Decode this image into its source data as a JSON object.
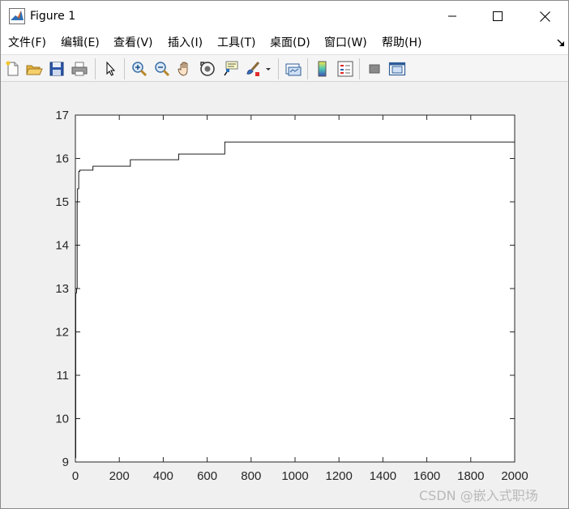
{
  "window": {
    "title": "Figure 1"
  },
  "menu": [
    {
      "label": "文件(F)"
    },
    {
      "label": "编辑(E)"
    },
    {
      "label": "查看(V)"
    },
    {
      "label": "插入(I)"
    },
    {
      "label": "工具(T)"
    },
    {
      "label": "桌面(D)"
    },
    {
      "label": "窗口(W)"
    },
    {
      "label": "帮助(H)"
    }
  ],
  "toolbar": {
    "icons": [
      "new-figure-icon",
      "open-file-icon",
      "save-icon",
      "print-icon",
      "pointer-icon",
      "zoom-in-icon",
      "zoom-out-icon",
      "pan-icon",
      "rotate-3d-icon",
      "data-cursor-icon",
      "brush-icon",
      "brush-dropdown-icon",
      "link-plot-icon",
      "colorbar-icon",
      "legend-icon",
      "hide-plot-tools-icon",
      "show-plot-tools-icon"
    ]
  },
  "chart_data": {
    "type": "line",
    "title": "",
    "xlabel": "",
    "ylabel": "",
    "xlim": [
      0,
      2000
    ],
    "ylim": [
      9,
      17
    ],
    "xticks": [
      0,
      200,
      400,
      600,
      800,
      1000,
      1200,
      1400,
      1600,
      1800,
      2000
    ],
    "yticks": [
      9,
      10,
      11,
      12,
      13,
      14,
      15,
      16,
      17
    ],
    "grid": false,
    "series": [
      {
        "color": "#000000",
        "step": true,
        "x": [
          0,
          2,
          5,
          8,
          10,
          15,
          20,
          80,
          250,
          470,
          680,
          2000
        ],
        "y": [
          9.1,
          12.9,
          13.0,
          15.0,
          15.3,
          15.7,
          15.73,
          15.82,
          15.97,
          16.1,
          16.38,
          16.38
        ]
      }
    ]
  },
  "watermark": {
    "text": "CSDN @嵌入式职场"
  }
}
